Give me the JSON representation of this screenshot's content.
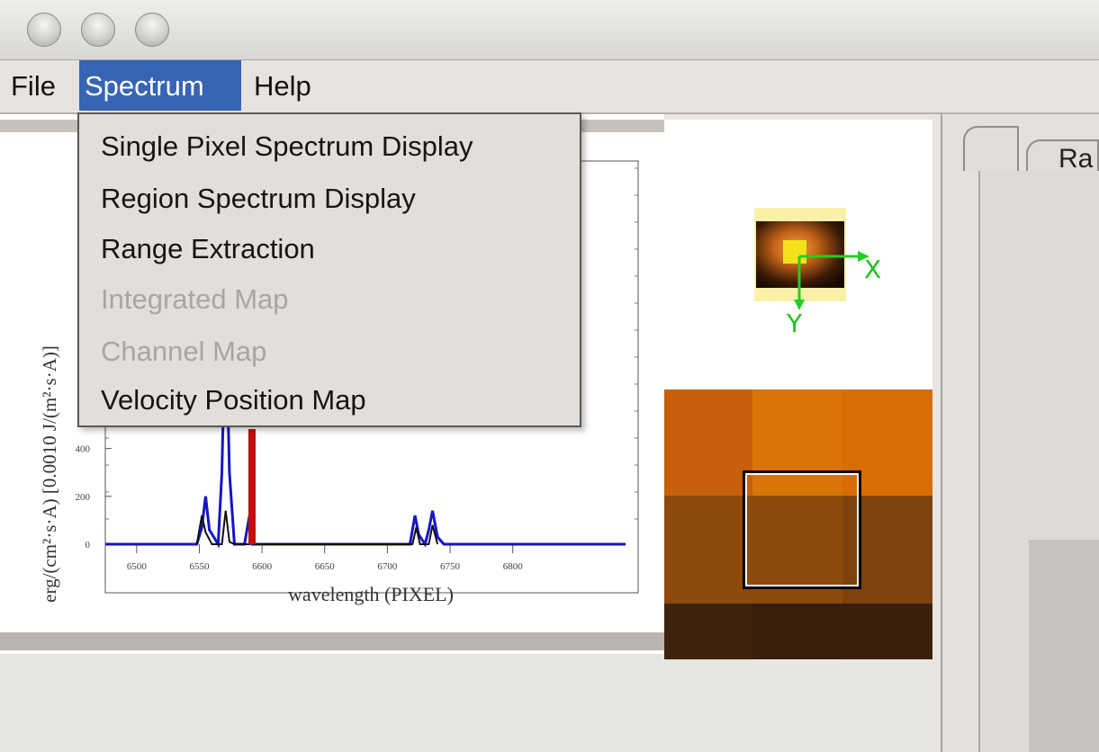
{
  "menubar": {
    "file": "File",
    "spectrum": "Spectrum",
    "help": "Help"
  },
  "spectrum_menu": {
    "items": [
      {
        "label": "Single Pixel Spectrum Display",
        "enabled": true
      },
      {
        "label": "Region Spectrum Display",
        "enabled": true
      },
      {
        "label": "Range Extraction",
        "enabled": true
      },
      {
        "label": "Integrated Map",
        "enabled": false
      },
      {
        "label": "Channel Map",
        "enabled": false
      },
      {
        "label": "Velocity Position Map",
        "enabled": true
      }
    ]
  },
  "tabs": {
    "ra_label": "Ra"
  },
  "thumbnail": {
    "x_axis_label": "X",
    "y_axis_label": "Y"
  },
  "chart_data": {
    "type": "line",
    "xlabel": "wavelength (PIXEL)",
    "ylabel": "erg/(cm²·s·A) [0.0010 J/(m²·s·A)]",
    "xlim": [
      6475,
      6900
    ],
    "ylim": [
      0,
      1000
    ],
    "x_ticks": [
      "6500",
      "6550",
      "6600",
      "6650",
      "6700",
      "6750",
      "6800"
    ],
    "y_ticks": [
      "0",
      "200",
      "400"
    ],
    "series": [
      {
        "color": "#1515c8",
        "points": [
          [
            6475,
            0
          ],
          [
            6548,
            0
          ],
          [
            6552,
            70
          ],
          [
            6555,
            200
          ],
          [
            6558,
            60
          ],
          [
            6565,
            0
          ],
          [
            6568,
            300
          ],
          [
            6571,
            1000
          ],
          [
            6574,
            300
          ],
          [
            6578,
            0
          ],
          [
            6586,
            0
          ],
          [
            6590,
            120
          ],
          [
            6592,
            0
          ],
          [
            6595,
            0
          ],
          [
            6718,
            0
          ],
          [
            6720,
            60
          ],
          [
            6722,
            120
          ],
          [
            6725,
            40
          ],
          [
            6730,
            0
          ],
          [
            6733,
            60
          ],
          [
            6736,
            140
          ],
          [
            6740,
            30
          ],
          [
            6745,
            0
          ],
          [
            6890,
            0
          ]
        ]
      },
      {
        "color": "#111111",
        "points": [
          [
            6548,
            0
          ],
          [
            6552,
            120
          ],
          [
            6555,
            50
          ],
          [
            6560,
            0
          ],
          [
            6568,
            0
          ],
          [
            6571,
            140
          ],
          [
            6574,
            10
          ],
          [
            6578,
            0
          ],
          [
            6590,
            0
          ],
          [
            6592,
            130
          ],
          [
            6594,
            0
          ],
          [
            6720,
            0
          ],
          [
            6723,
            70
          ],
          [
            6726,
            0
          ],
          [
            6733,
            0
          ],
          [
            6736,
            80
          ],
          [
            6740,
            0
          ]
        ]
      }
    ],
    "markers": [
      {
        "x": 6592,
        "label": "",
        "color": "#c01010"
      }
    ]
  },
  "pixel_grid": {
    "colors": [
      [
        "#c85f0a",
        "#d97407",
        "#d86d05"
      ],
      [
        "#8d4a0d",
        "#8d4a0d",
        "#7f420d"
      ],
      [
        "#3f230d",
        "#381f0b",
        "#3a200c"
      ]
    ]
  }
}
